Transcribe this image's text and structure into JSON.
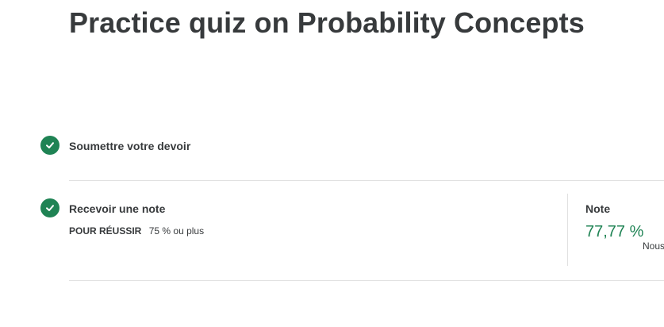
{
  "page": {
    "title": "Practice quiz on Probability Concepts"
  },
  "steps": [
    {
      "title": "Soumettre votre devoir",
      "status": "completed",
      "icon": "check-circle-icon"
    },
    {
      "title": "Recevoir une note",
      "status": "completed",
      "icon": "check-circle-icon",
      "pass_label": "POUR RÉUSSIR",
      "pass_value": "75 % ou plus"
    }
  ],
  "grade": {
    "label": "Note",
    "value": "77,77 %",
    "note": "Nous"
  },
  "colors": {
    "success": "#1f8354",
    "text": "#373a3c",
    "divider": "#e1e1e1"
  }
}
